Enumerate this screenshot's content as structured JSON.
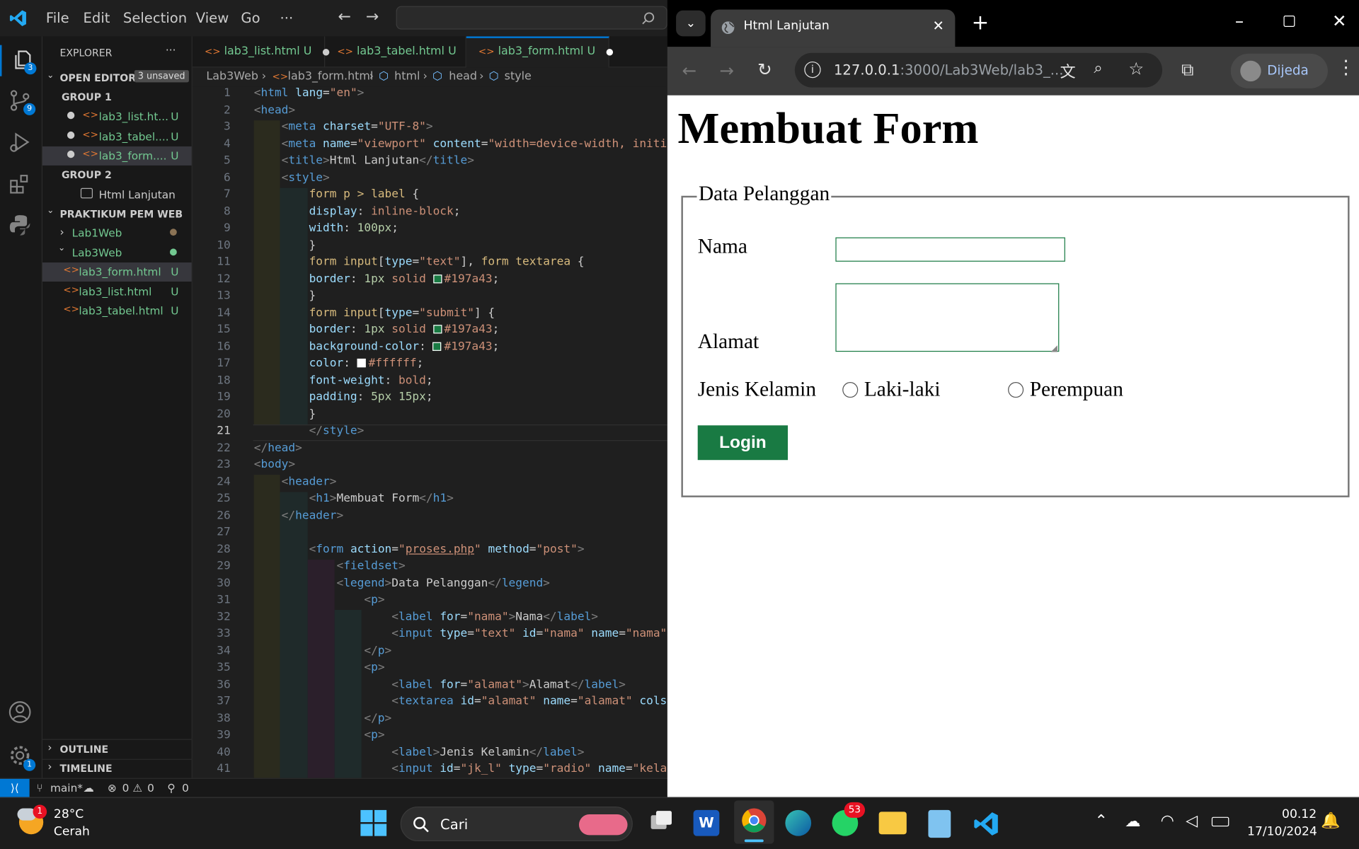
{
  "vscode": {
    "menu": [
      "File",
      "Edit",
      "Selection",
      "View",
      "Go",
      "···"
    ],
    "explorer_title": "EXPLORER",
    "open_editors": "OPEN EDITORS",
    "unsaved_badge": "3 unsaved",
    "group1": "GROUP 1",
    "group1_files": [
      {
        "name": "lab3_list.ht...",
        "status": "U"
      },
      {
        "name": "lab3_tabel....",
        "status": "U"
      },
      {
        "name": "lab3_form....",
        "status": "U"
      }
    ],
    "group2": "GROUP 2",
    "group2_item": "Html Lanjutan",
    "project": "PRAKTIKUM PEM WEB",
    "folders": [
      "Lab1Web",
      "Lab3Web"
    ],
    "project_files": [
      {
        "name": "lab3_form.html",
        "status": "U"
      },
      {
        "name": "lab3_list.html",
        "status": "U"
      },
      {
        "name": "lab3_tabel.html",
        "status": "U"
      }
    ],
    "outline": "OUTLINE",
    "timeline": "TIMELINE",
    "badges": {
      "explorer": "3",
      "scm": "9",
      "settings": "1"
    },
    "tabs": [
      {
        "label": "lab3_list.html",
        "status": "U"
      },
      {
        "label": "lab3_tabel.html",
        "status": "U"
      },
      {
        "label": "lab3_form.html",
        "status": "U"
      }
    ],
    "breadcrumb": [
      "Lab3Web",
      "lab3_form.html",
      "html",
      "head",
      "style"
    ],
    "status": {
      "branch": "main*",
      "errors": "0",
      "warnings": "0",
      "ports": "0"
    },
    "code_lines": [
      "1",
      "2",
      "3",
      "4",
      "5",
      "6",
      "7",
      "8",
      "9",
      "10",
      "11",
      "12",
      "13",
      "14",
      "15",
      "16",
      "17",
      "18",
      "19",
      "20",
      "21",
      "22",
      "23",
      "24",
      "25",
      "26",
      "27",
      "28",
      "29",
      "30",
      "31",
      "32",
      "33",
      "34",
      "35",
      "36",
      "37",
      "38",
      "39",
      "40",
      "41"
    ],
    "colors": {
      "accent": "#0078d4",
      "untracked": "#73c991",
      "swatch_green": "#197a43",
      "swatch_white": "#ffffff"
    }
  },
  "browser": {
    "tab_title": "Html Lanjutan",
    "url_host": "127.0.0.1",
    "url_rest": ":3000/Lab3Web/lab3_...",
    "profile": "Dijeda"
  },
  "page": {
    "heading": "Membuat Form",
    "legend": "Data Pelanggan",
    "label_nama": "Nama",
    "label_alamat": "Alamat",
    "label_jk": "Jenis Kelamin",
    "radio1": "Laki-laki",
    "radio2": "Perempuan",
    "submit": "Login",
    "accent": "#197a43"
  },
  "taskbar": {
    "temp": "28°C",
    "weather": "Cerah",
    "weather_badge": "1",
    "search": "Cari",
    "whatsapp_badge": "53",
    "time": "00.12",
    "date": "17/10/2024"
  }
}
